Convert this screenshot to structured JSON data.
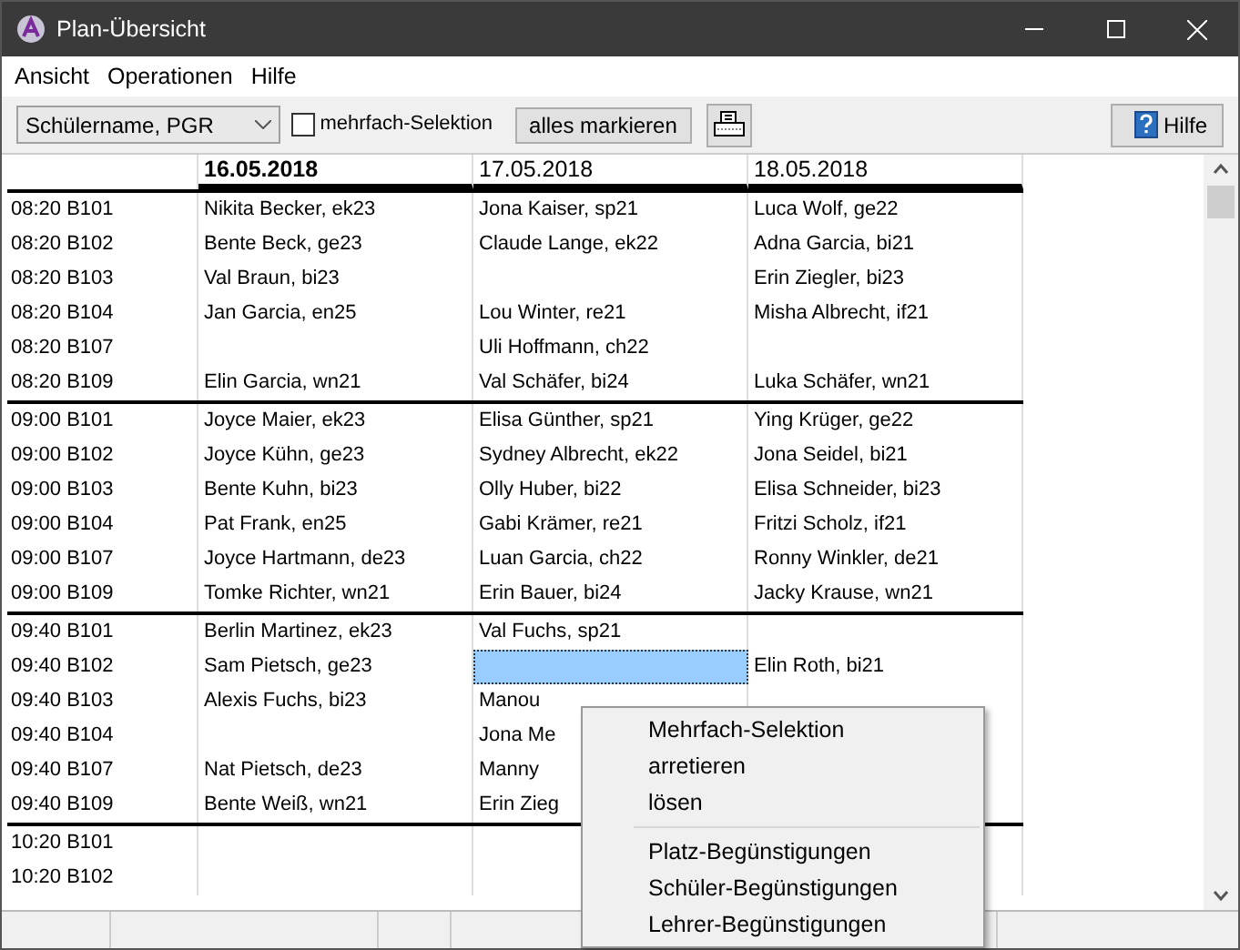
{
  "window": {
    "title": "Plan-Übersicht"
  },
  "menu": [
    "Ansicht",
    "Operationen",
    "Hilfe"
  ],
  "toolbar": {
    "view_select": "Schülername, PGR",
    "multi_select": {
      "label": "mehrfach-Selektion",
      "checked": false
    },
    "mark_all": "alles markieren",
    "help": "Hilfe"
  },
  "dates": [
    {
      "label": "16.05.2018",
      "selected": true
    },
    {
      "label": "17.05.2018",
      "selected": false
    },
    {
      "label": "18.05.2018",
      "selected": false
    }
  ],
  "groups": [
    {
      "rows": [
        {
          "slot": "08:20 B101",
          "cells": [
            {
              "text": "Nikita Becker, ek23",
              "selected": false
            },
            {
              "text": "Jona Kaiser, sp21",
              "selected": false
            },
            {
              "text": "Luca Wolf, ge22",
              "selected": false
            }
          ]
        },
        {
          "slot": "08:20 B102",
          "cells": [
            {
              "text": "Bente Beck, ge23",
              "selected": false
            },
            {
              "text": "Claude Lange, ek22",
              "selected": false
            },
            {
              "text": "Adna Garcia, bi21",
              "selected": false
            }
          ]
        },
        {
          "slot": "08:20 B103",
          "cells": [
            {
              "text": "Val Braun, bi23",
              "selected": false
            },
            {
              "selected": false
            },
            {
              "text": "Erin Ziegler, bi23",
              "selected": false
            }
          ]
        },
        {
          "slot": "08:20 B104",
          "cells": [
            {
              "text": "Jan Garcia, en25",
              "selected": false
            },
            {
              "text": "Lou Winter, re21",
              "selected": false
            },
            {
              "text": "Misha Albrecht, if21",
              "selected": false
            }
          ]
        },
        {
          "slot": "08:20 B107",
          "cells": [
            {
              "selected": false
            },
            {
              "text": "Uli Hoffmann, ch22",
              "selected": false
            },
            {
              "selected": false
            }
          ]
        },
        {
          "slot": "08:20 B109",
          "cells": [
            {
              "text": "Elin Garcia, wn21",
              "selected": false
            },
            {
              "text": "Val Schäfer, bi24",
              "selected": false
            },
            {
              "text": "Luka Schäfer, wn21",
              "selected": false
            }
          ]
        }
      ]
    },
    {
      "rows": [
        {
          "slot": "09:00 B101",
          "cells": [
            {
              "text": "Joyce Maier, ek23",
              "selected": false
            },
            {
              "text": "Elisa Günther, sp21",
              "selected": false
            },
            {
              "text": "Ying Krüger, ge22",
              "selected": false
            }
          ]
        },
        {
          "slot": "09:00 B102",
          "cells": [
            {
              "text": "Joyce Kühn, ge23",
              "selected": false
            },
            {
              "text": "Sydney Albrecht, ek22",
              "selected": false
            },
            {
              "text": "Jona Seidel, bi21",
              "selected": false
            }
          ]
        },
        {
          "slot": "09:00 B103",
          "cells": [
            {
              "text": "Bente Kuhn, bi23",
              "selected": false
            },
            {
              "text": "Olly Huber, bi22",
              "selected": false
            },
            {
              "text": "Elisa Schneider, bi23",
              "selected": false
            }
          ]
        },
        {
          "slot": "09:00 B104",
          "cells": [
            {
              "text": "Pat Frank, en25",
              "selected": false
            },
            {
              "text": "Gabi Krämer, re21",
              "selected": false
            },
            {
              "text": "Fritzi Scholz, if21",
              "selected": false
            }
          ]
        },
        {
          "slot": "09:00 B107",
          "cells": [
            {
              "text": "Joyce Hartmann, de23",
              "selected": false
            },
            {
              "text": "Luan Garcia, ch22",
              "selected": false
            },
            {
              "text": "Ronny Winkler, de21",
              "selected": false
            }
          ]
        },
        {
          "slot": "09:00 B109",
          "cells": [
            {
              "text": "Tomke Richter, wn21",
              "selected": false
            },
            {
              "text": "Erin Bauer, bi24",
              "selected": false
            },
            {
              "text": "Jacky Krause, wn21",
              "selected": false
            }
          ]
        }
      ]
    },
    {
      "rows": [
        {
          "slot": "09:40 B101",
          "cells": [
            {
              "text": "Berlin Martinez, ek23",
              "selected": false
            },
            {
              "text": "Val Fuchs, sp21",
              "selected": false
            },
            {
              "selected": false
            }
          ]
        },
        {
          "slot": "09:40 B102",
          "cells": [
            {
              "text": "Sam Pietsch, ge23",
              "selected": false
            },
            {
              "selected": true
            },
            {
              "text": "Elin Roth, bi21",
              "selected": false
            }
          ]
        },
        {
          "slot": "09:40 B103",
          "cells": [
            {
              "text": "Alexis Fuchs, bi23",
              "selected": false
            },
            {
              "text": "Manou",
              "selected": false
            },
            {
              "selected": false
            }
          ]
        },
        {
          "slot": "09:40 B104",
          "cells": [
            {
              "selected": false
            },
            {
              "text": "Jona Me",
              "selected": false
            },
            {
              "selected": false
            }
          ]
        },
        {
          "slot": "09:40 B107",
          "cells": [
            {
              "text": "Nat Pietsch, de23",
              "selected": false
            },
            {
              "text": "Manny",
              "selected": false
            },
            {
              "selected": false
            }
          ]
        },
        {
          "slot": "09:40 B109",
          "cells": [
            {
              "text": "Bente Weiß, wn21",
              "selected": false
            },
            {
              "text": "Erin Zieg",
              "selected": false
            },
            {
              "selected": false
            }
          ]
        }
      ]
    },
    {
      "rows": [
        {
          "slot": "10:20 B101",
          "cells": [
            {
              "selected": false
            },
            {
              "selected": false
            },
            {
              "selected": false
            }
          ]
        },
        {
          "slot": "10:20 B102",
          "cells": [
            {
              "selected": false
            },
            {
              "selected": false
            },
            {
              "selected": false
            }
          ]
        }
      ]
    }
  ],
  "context_menu": [
    {
      "items": [
        "Mehrfach-Selektion",
        "arretieren",
        "lösen"
      ]
    },
    {
      "items": [
        "Platz-Begünstigungen",
        "Schüler-Begünstigungen",
        "Lehrer-Begünstigungen"
      ]
    }
  ]
}
